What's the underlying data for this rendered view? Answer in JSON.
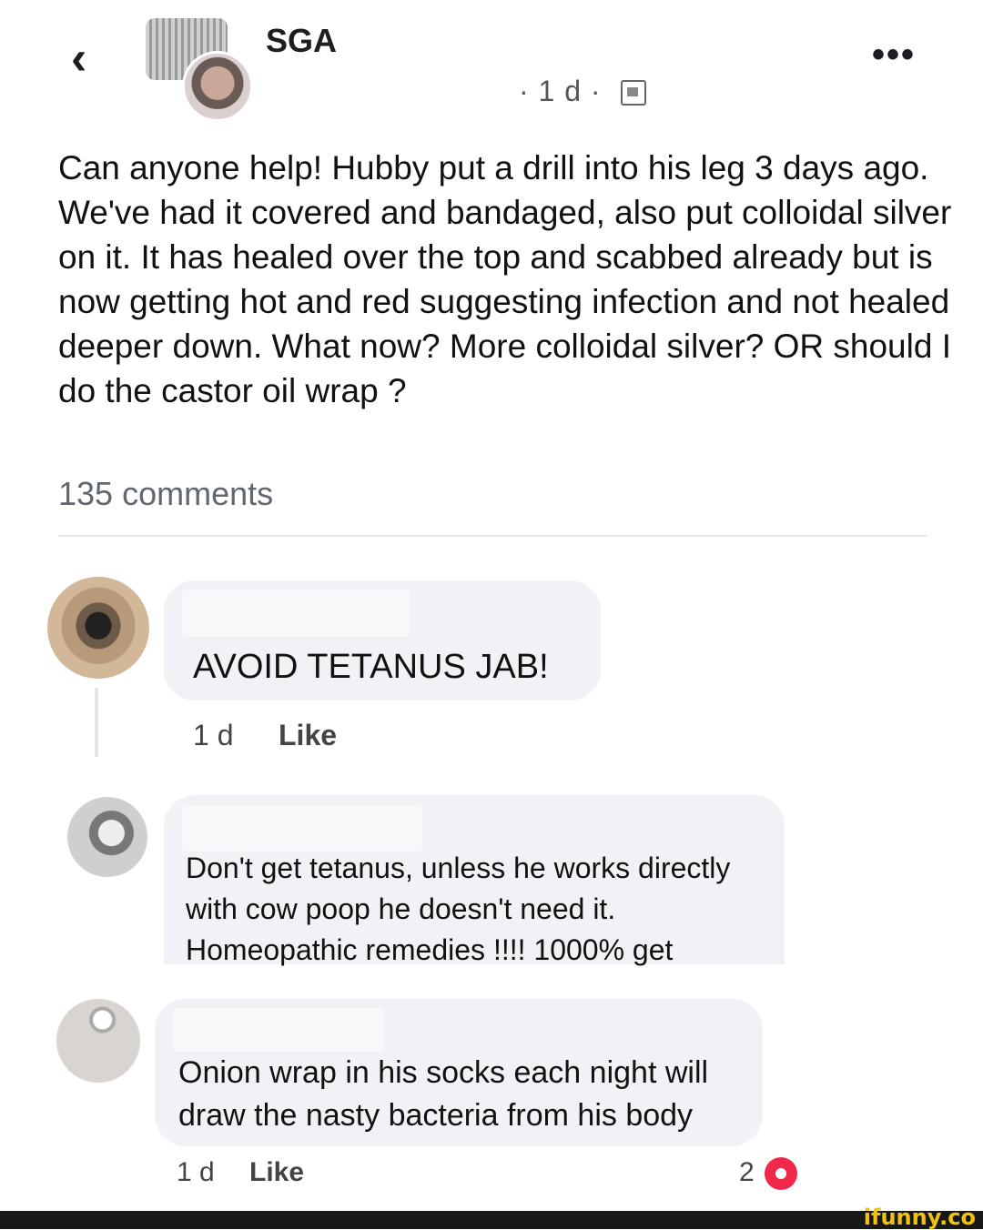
{
  "header": {
    "back_icon": "chevron-left-icon",
    "group_name": "SGA",
    "meta_time": "· 1 d ·",
    "privacy_icon": "members-icon",
    "more_label": "•••"
  },
  "post": {
    "text": "Can anyone help! Hubby put a drill into his leg 3 days ago. We've had it covered and bandaged, also put colloidal silver on it. It has healed over the top and scabbed already but is now getting hot and red suggesting infection and not healed deeper down. What now? More colloidal silver? OR should I do the castor oil wrap ?",
    "comments_count": "135 comments"
  },
  "comments": [
    {
      "text": "AVOID TETANUS JAB!",
      "time": "1 d",
      "like_label": "Like"
    },
    {
      "text": "Don't get tetanus, unless he works directly with cow poop he doesn't need it. Homeopathic remedies !!!! 1000% get"
    },
    {
      "text": "Onion wrap in his socks each night will draw the nasty bacteria from his body",
      "time": "1 d",
      "like_label": "Like",
      "reaction_count": "2",
      "reaction_icon": "heart-icon"
    }
  ],
  "watermark": "ifunny.co",
  "colors": {
    "bubble": "#f0f2f5",
    "heart": "#f0284a",
    "watermark": "#f4c20d"
  }
}
